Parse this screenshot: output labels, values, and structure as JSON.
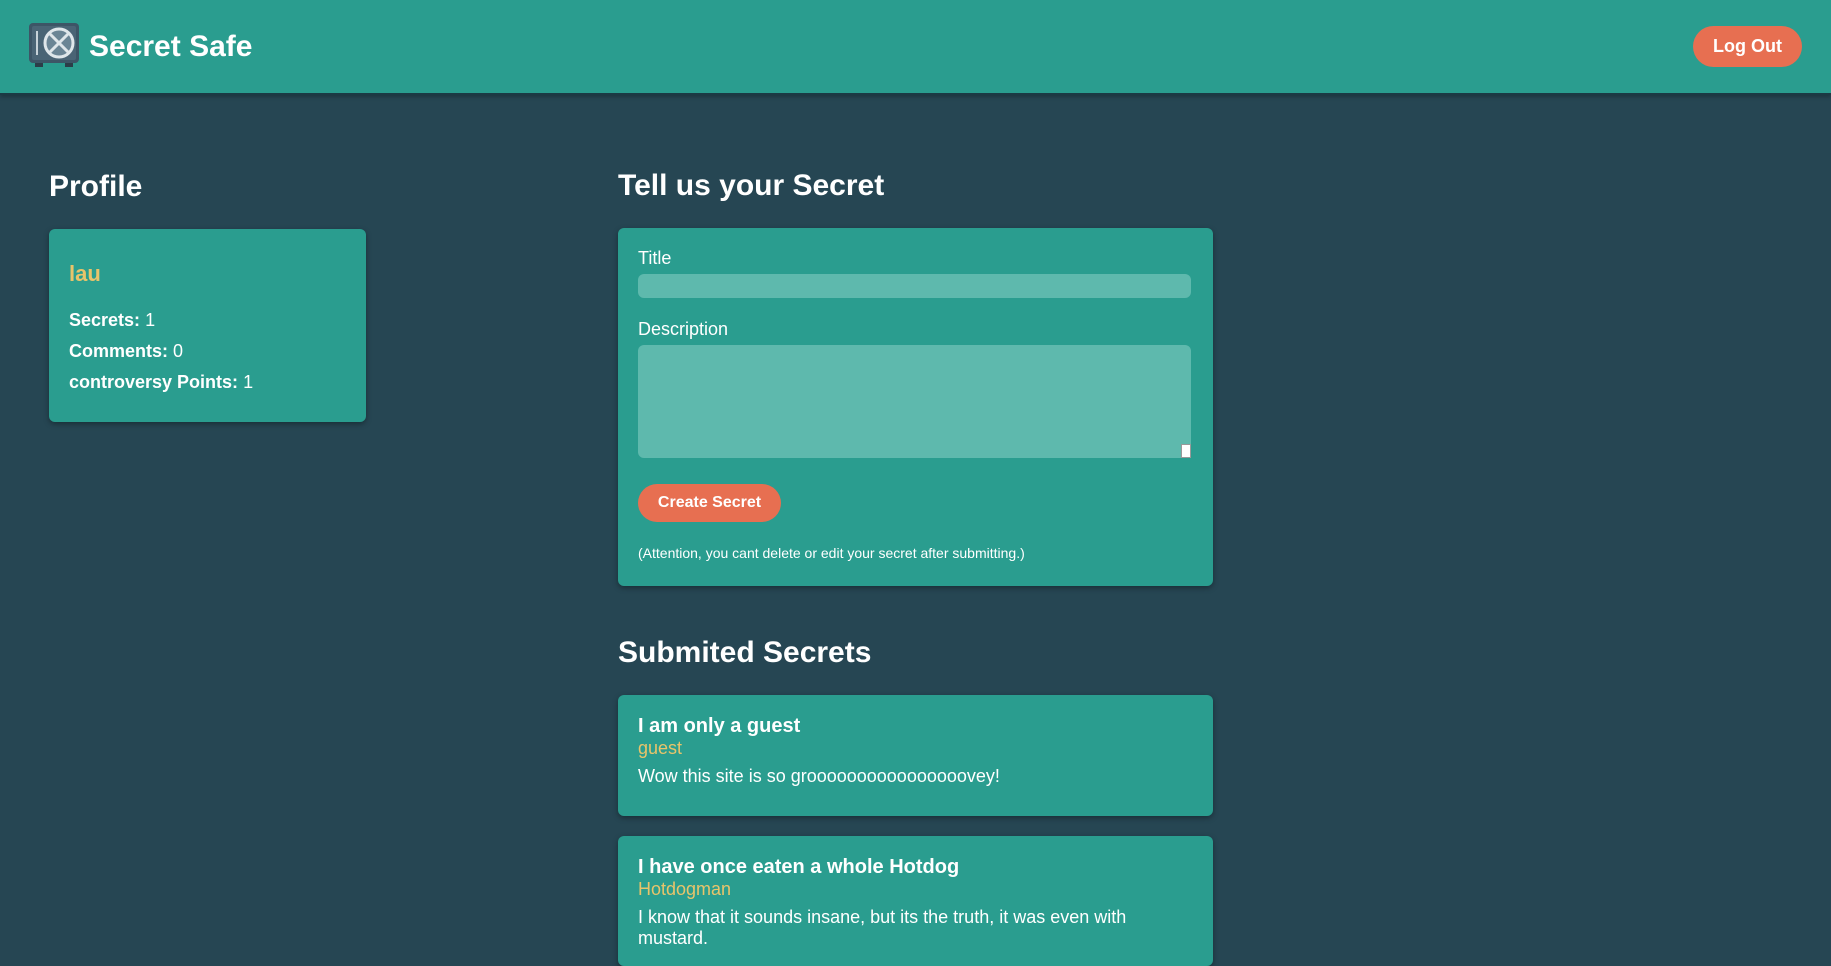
{
  "header": {
    "app_name": "Secret Safe",
    "logo_icon": "safe-icon",
    "logout_label": "Log Out"
  },
  "profile": {
    "heading": "Profile",
    "username": "lau",
    "stats": [
      {
        "label": "Secrets:",
        "value": "1"
      },
      {
        "label": "Comments:",
        "value": "0"
      },
      {
        "label": "controversy Points:",
        "value": "1"
      }
    ]
  },
  "form": {
    "heading": "Tell us your Secret",
    "title_label": "Title",
    "title_value": "",
    "description_label": "Description",
    "description_value": "",
    "submit_label": "Create Secret",
    "note": "(Attention, you cant delete or edit your secret after submitting.)"
  },
  "submitted": {
    "heading": "Submited Secrets",
    "secrets": [
      {
        "title": "I am only a guest",
        "author": "guest",
        "description": "Wow this site is so groooooooooooooooovey!"
      },
      {
        "title": "I have once eaten a whole Hotdog",
        "author": "Hotdogman",
        "description": "I know that it sounds insane, but its the truth, it was even with mustard."
      }
    ]
  },
  "colors": {
    "background": "#264653",
    "card": "#2a9d8f",
    "accent": "#e76f51",
    "highlight": "#e9c46a"
  }
}
